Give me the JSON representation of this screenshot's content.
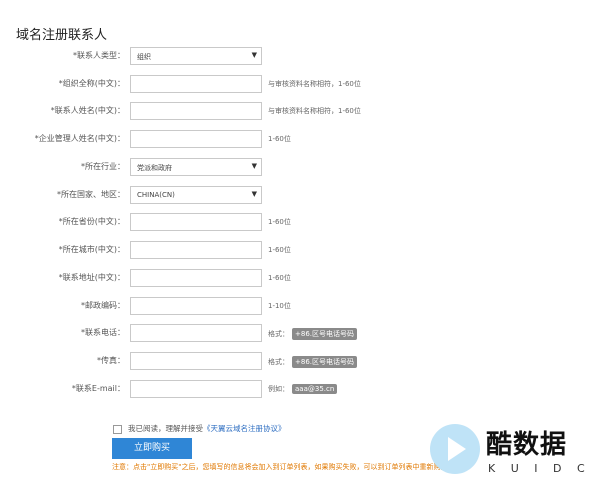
{
  "section_title": "域名注册联系人",
  "fields": [
    {
      "label": "*联系人类型：",
      "type": "select",
      "value": "组织",
      "hint": ""
    },
    {
      "label": "*组织全称(中文)：",
      "type": "input",
      "value": "",
      "hint": "与审核资料名称相符，1-60位"
    },
    {
      "label": "*联系人姓名(中文)：",
      "type": "input",
      "value": "",
      "hint": "与审核资料名称相符，1-60位"
    },
    {
      "label": "*企业管理人姓名(中文)：",
      "type": "input",
      "value": "",
      "hint": "1-60位"
    },
    {
      "label": "*所在行业：",
      "type": "select",
      "value": "党派和政府",
      "hint": ""
    },
    {
      "label": "*所在国家、地区：",
      "type": "select",
      "value": "CHINA(CN)",
      "hint": ""
    },
    {
      "label": "*所在省份(中文)：",
      "type": "input",
      "value": "",
      "hint": "1-60位"
    },
    {
      "label": "*所在城市(中文)：",
      "type": "input",
      "value": "",
      "hint": "1-60位"
    },
    {
      "label": "*联系地址(中文)：",
      "type": "input",
      "value": "",
      "hint": "1-60位"
    },
    {
      "label": "*邮政编码：",
      "type": "input",
      "value": "",
      "hint": "1-10位"
    },
    {
      "label": "*联系电话：",
      "type": "input",
      "value": "",
      "hint": "格式：",
      "badge": "+86.区号电话号码"
    },
    {
      "label": "*传真：",
      "type": "input",
      "value": "",
      "hint": "格式：",
      "badge": "+86.区号电话号码"
    },
    {
      "label": "*联系E-mail：",
      "type": "input",
      "value": "",
      "hint": "例如：",
      "badge": "aaa@35.cn"
    }
  ],
  "agreement": {
    "prefix": "我已阅读，理解并接受",
    "link": "《天翼云域名注册协议》"
  },
  "buy_button": "立即购买",
  "note": "注意：点击\"立即购买\"之后，您填写的信息将会加入到订单列表，如果购买失败，可以到订单列表中重新购买",
  "watermark": {
    "brand": "酷数据",
    "sub": "K U I D C"
  }
}
